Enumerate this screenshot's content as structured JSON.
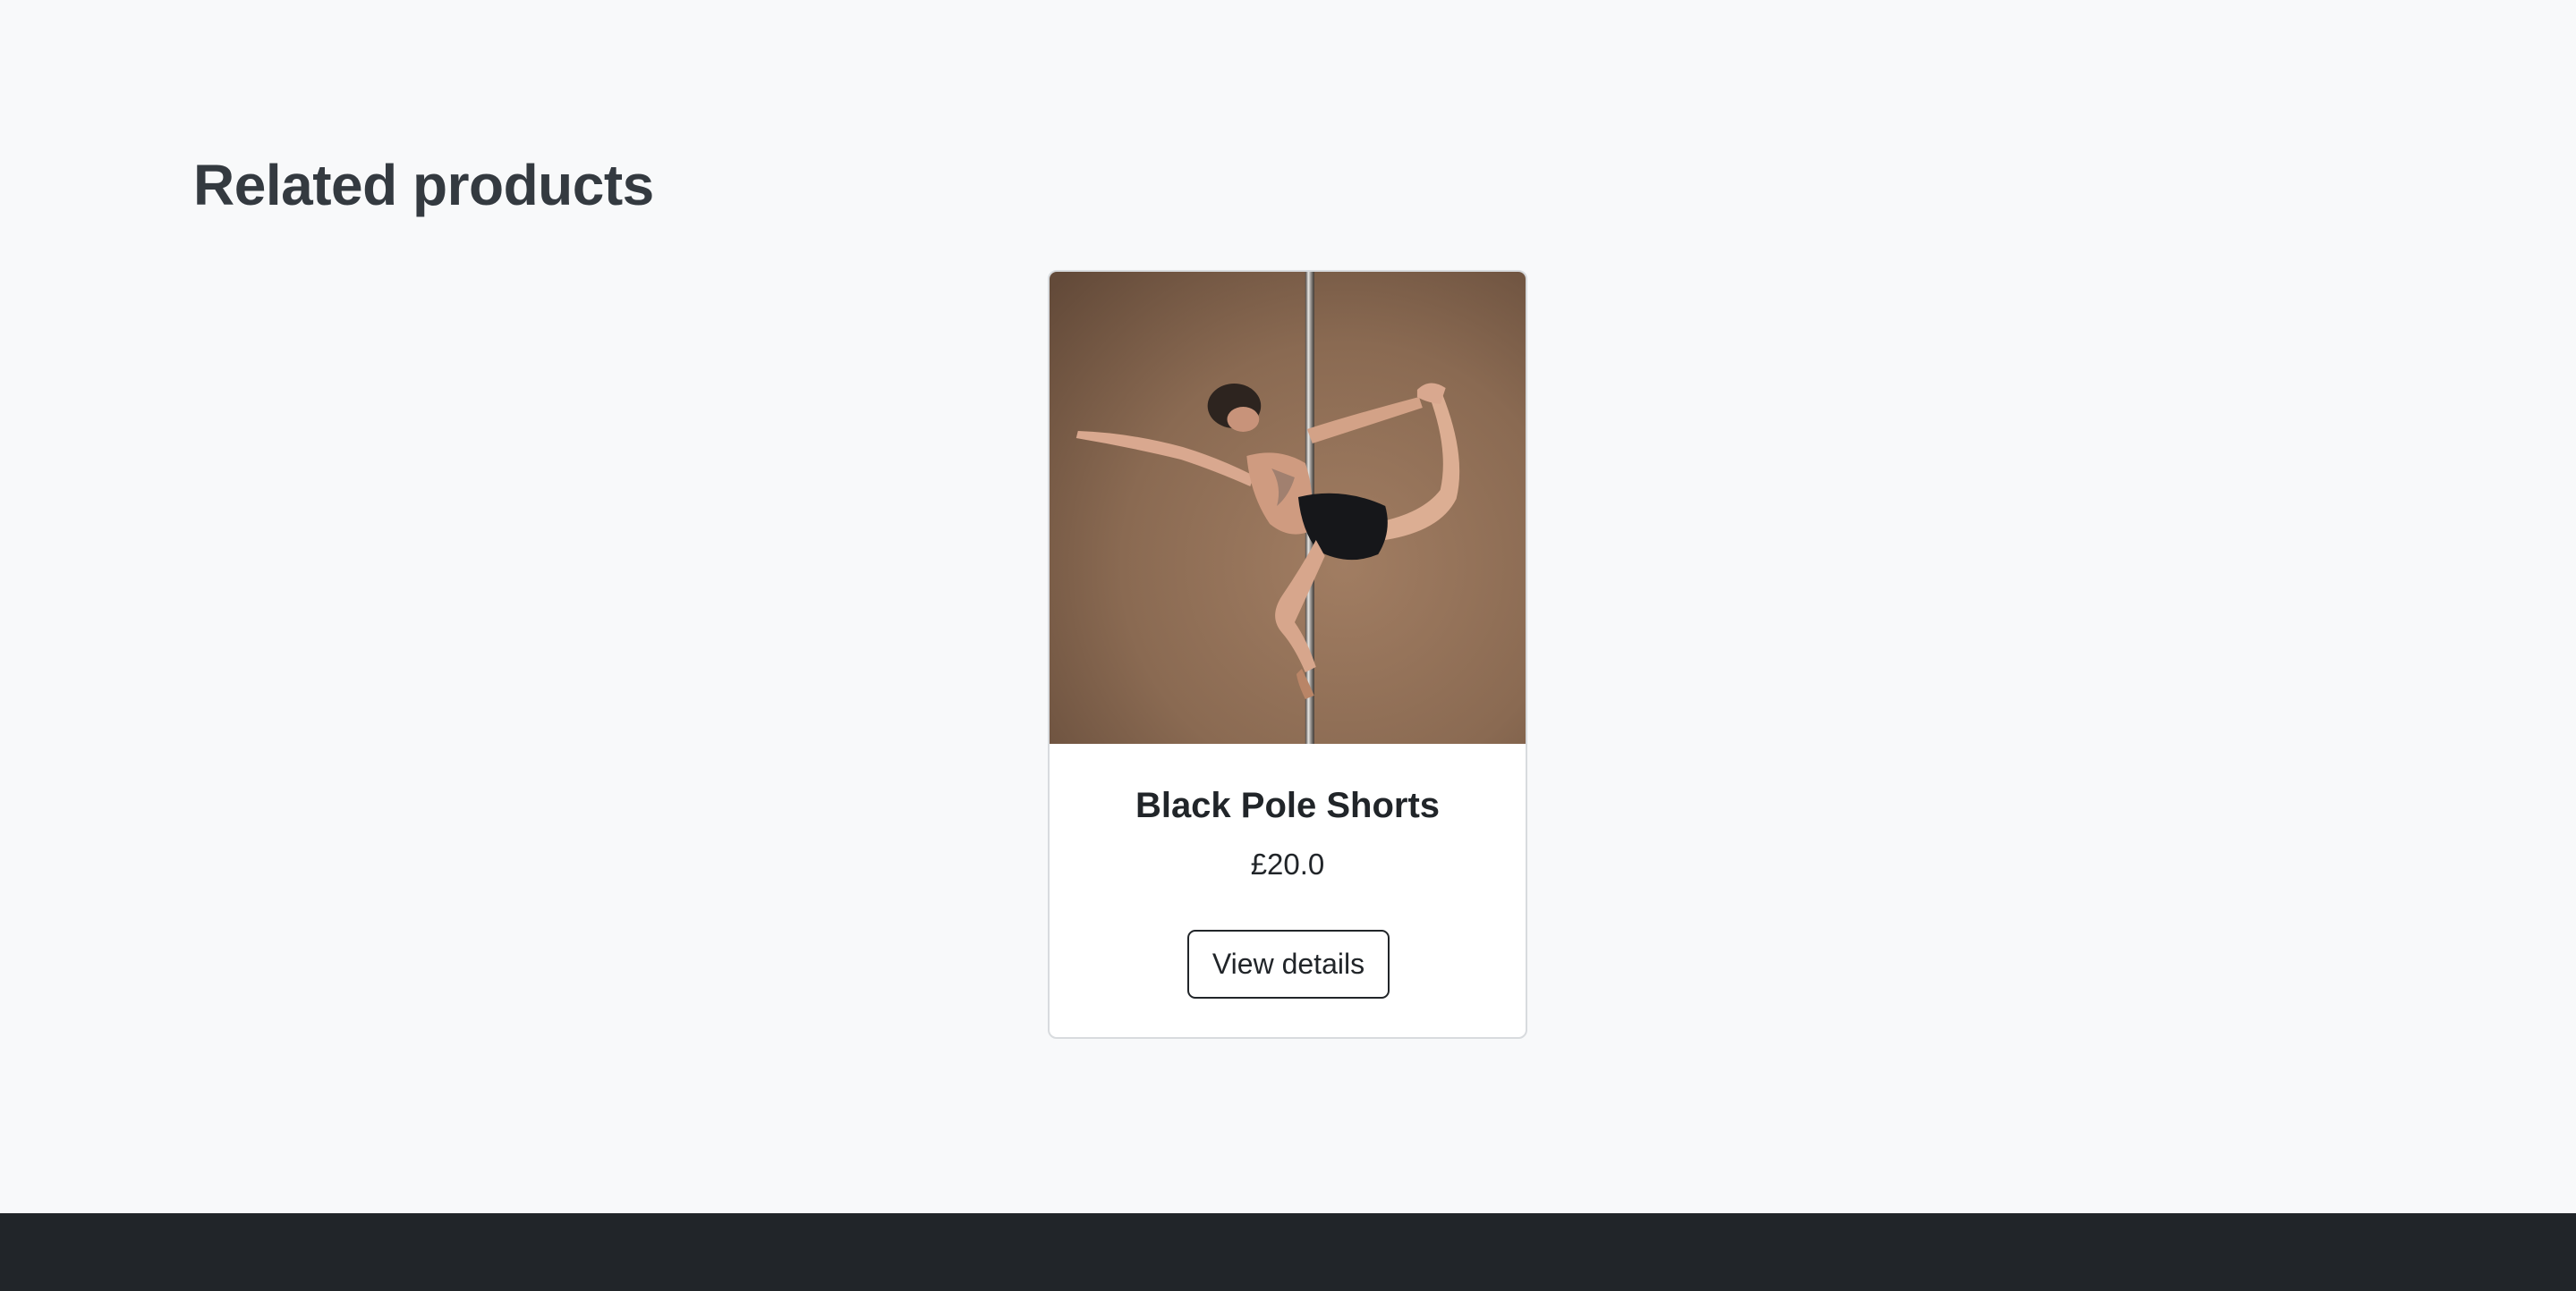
{
  "section": {
    "heading": "Related products"
  },
  "products": [
    {
      "name": "Black Pole Shorts",
      "price": "£20.0",
      "button_label": "View details",
      "image_alt": "Black Pole Shorts"
    }
  ],
  "colors": {
    "page_background": "#f8f9fa",
    "heading_text": "#343a40",
    "footer_background": "#212529",
    "card_background": "#ffffff",
    "photo_background": "#8b6a52"
  }
}
